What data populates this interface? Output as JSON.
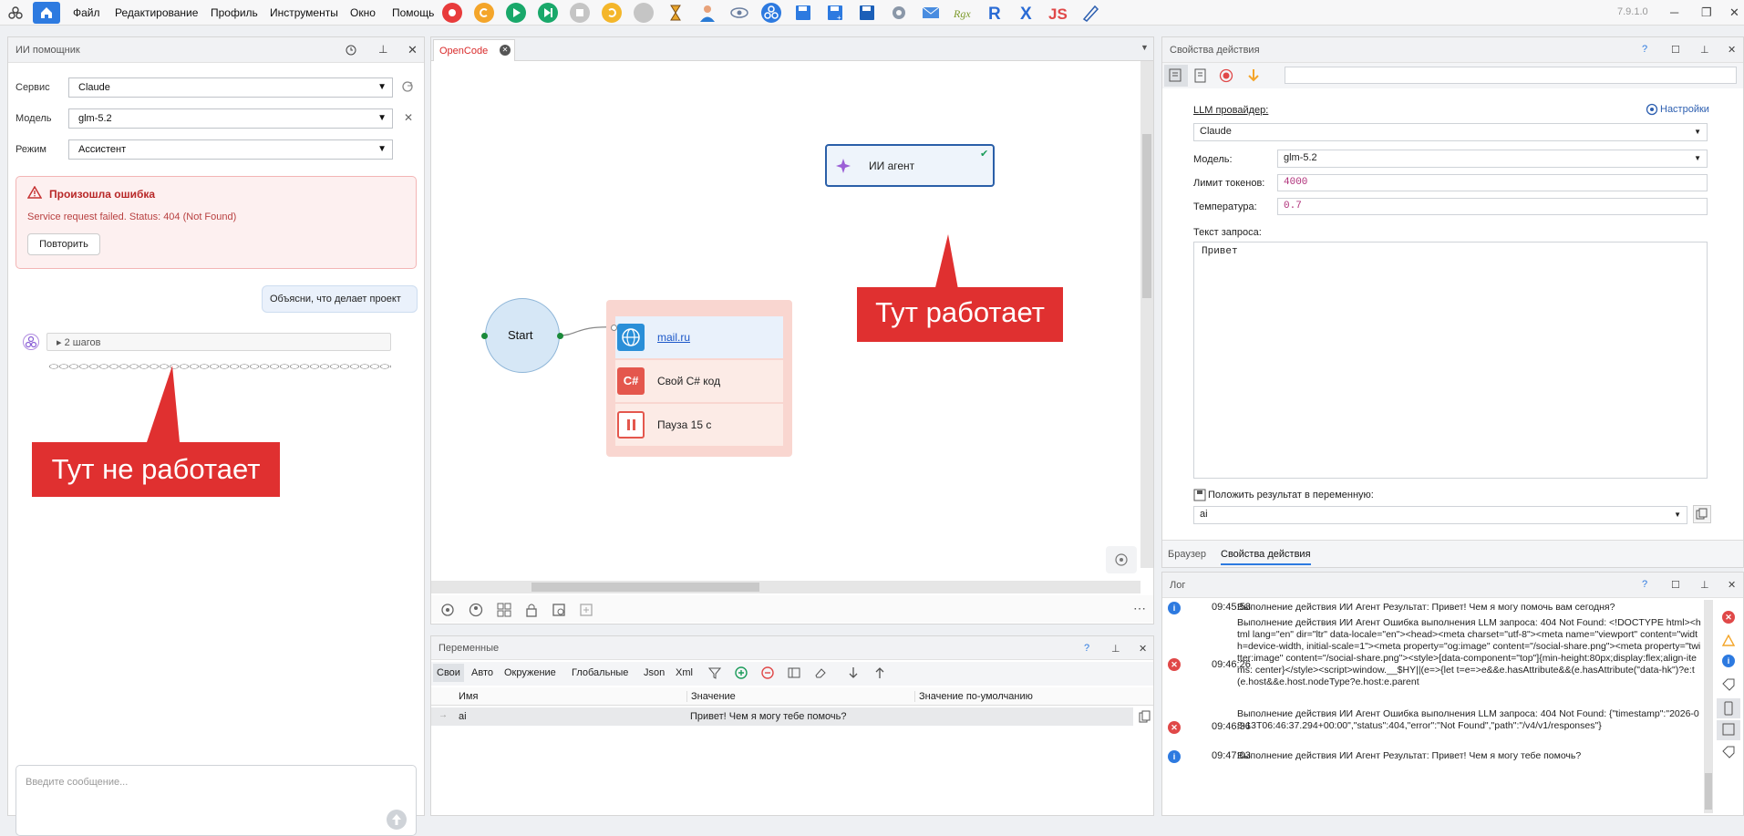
{
  "app": {
    "version": "7.9.1.0"
  },
  "menu": [
    "Файл",
    "Редактирование",
    "Профиль",
    "Инструменты",
    "Окно",
    "Помощь"
  ],
  "toolbar_icons": [
    "record-icon",
    "refresh-icon",
    "play-icon",
    "step-icon",
    "stop-icon",
    "undo-icon",
    "pause-icon",
    "hourglass-icon",
    "user-icon",
    "eye-icon",
    "share-icon",
    "save-icon",
    "save-as-icon",
    "save-all-icon",
    "gear-icon",
    "mail-icon",
    "regex-icon",
    "r-icon",
    "x-icon",
    "js-icon",
    "edit-icon"
  ],
  "left": {
    "title": "ИИ помощник",
    "service_label": "Сервис",
    "service_value": "Claude",
    "model_label": "Модель",
    "model_value": "glm-5.2",
    "mode_label": "Режим",
    "mode_value": "Ассистент",
    "error_title": "Произошла ошибка",
    "error_text": "Service request failed. Status: 404 (Not Found)",
    "retry_label": "Повторить",
    "user_message": "Объясни, что делает проект",
    "steps_label": "2 шагов",
    "callout": "Тут не работает",
    "input_placeholder": "Введите сообщение..."
  },
  "center": {
    "tab_label": "OpenCode",
    "node_agent": "ИИ агент",
    "node_start": "Start",
    "node_url": "mail.ru",
    "node_csharp": "Свой C# код",
    "node_csharp_badge": "C#",
    "node_pause": "Пауза 15 с",
    "callout": "Тут работает"
  },
  "vars": {
    "title": "Переменные",
    "tabs": [
      "Свои",
      "Авто",
      "Окружение",
      "Глобальные",
      "Json",
      "Xml"
    ],
    "columns": [
      "Имя",
      "Значение",
      "Значение по-умолчанию"
    ],
    "rows": [
      {
        "name": "ai",
        "value": "Привет! Чем я могу тебе помочь?",
        "default": ""
      }
    ]
  },
  "props": {
    "title": "Свойства действия",
    "provider_label": "LLM провайдер:",
    "settings_label": "Настройки",
    "provider_value": "Claude",
    "model_label": "Модель:",
    "model_value": "glm-5.2",
    "tokens_label": "Лимит токенов:",
    "tokens_value": "4000",
    "temp_label": "Температура:",
    "temp_value": "0.7",
    "prompt_label": "Текст запроса:",
    "prompt_value": "Привет",
    "result_label": "Положить результат в переменную:",
    "result_value": "ai",
    "bottom_tabs": [
      "Браузер",
      "Свойства действия"
    ]
  },
  "log": {
    "title": "Лог",
    "entries": [
      {
        "time": "09:45:58",
        "type": "info",
        "msg": "Выполнение действия ИИ Агент Результат: Привет! Чем я могу помочь вам сегодня?"
      },
      {
        "time": "09:46:26",
        "type": "error",
        "msg": "Выполнение действия ИИ Агент Ошибка выполнения LLM запроса: 404 Not Found: <!DOCTYPE html><html lang=\"en\" dir=\"ltr\" data-locale=\"en\"><head><meta charset=\"utf-8\"><meta name=\"viewport\" content=\"width=device-width, initial-scale=1\"><meta property=\"og:image\" content=\"/social-share.png\"><meta property=\"twitter:image\" content=\"/social-share.png\"><style>[data-component=\"top\"]{min-height:80px;display:flex;align-items: center}</style><script>window.__$HY||(e=>{let t=e=>e&&e.hasAttribute&&(e.hasAttribute(\"data-hk\")?e:t(e.host&&e.host.nodeType?e.host:e.parent"
      },
      {
        "time": "09:46:36",
        "type": "error",
        "msg": "Выполнение действия ИИ Агент Ошибка выполнения LLM запроса: 404 Not Found: {\"timestamp\":\"2026-08-13T06:46:37.294+00:00\",\"status\":404,\"error\":\"Not Found\",\"path\":\"/v4/v1/responses\"}"
      },
      {
        "time": "09:47:03",
        "type": "info",
        "msg": "Выполнение действия ИИ Агент Результат: Привет! Чем я могу тебе помочь?"
      }
    ]
  },
  "colors": {
    "accent": "#2d7ae0",
    "error": "#e04848",
    "callout": "#e03030"
  }
}
